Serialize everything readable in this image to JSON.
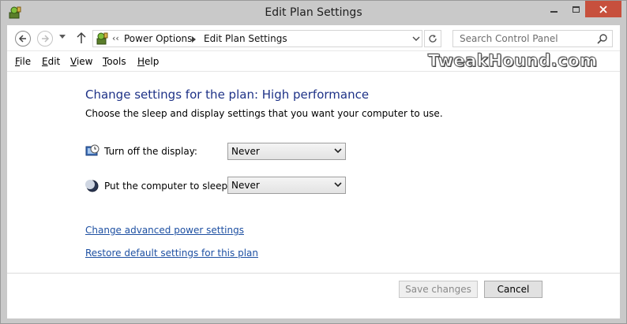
{
  "window": {
    "title": "Edit Plan Settings",
    "close_color": "#c7503d"
  },
  "nav": {
    "breadcrumb_prefix": "‹‹",
    "breadcrumb": [
      "Power Options",
      "Edit Plan Settings"
    ],
    "search_placeholder": "Search Control Panel"
  },
  "menu": {
    "items": [
      {
        "first": "F",
        "rest": "ile"
      },
      {
        "first": "E",
        "rest": "dit"
      },
      {
        "first": "V",
        "rest": "iew"
      },
      {
        "first": "T",
        "rest": "ools"
      },
      {
        "first": "H",
        "rest": "elp"
      }
    ],
    "watermark": "TweakHound.com"
  },
  "content": {
    "heading": "Change settings for the plan: High performance",
    "subheading": "Choose the sleep and display settings that you want your computer to use.",
    "settings": [
      {
        "label": "Turn off the display:",
        "value": "Never",
        "icon": "display-timer-icon"
      },
      {
        "label": "Put the computer to sleep:",
        "value": "Never",
        "icon": "sleep-moon-icon"
      }
    ],
    "links": [
      "Change advanced power settings",
      "Restore default settings for this plan"
    ],
    "heading_color": "#1e3287",
    "link_color": "#1e50a2"
  },
  "footer": {
    "save_label": "Save changes",
    "cancel_label": "Cancel"
  }
}
